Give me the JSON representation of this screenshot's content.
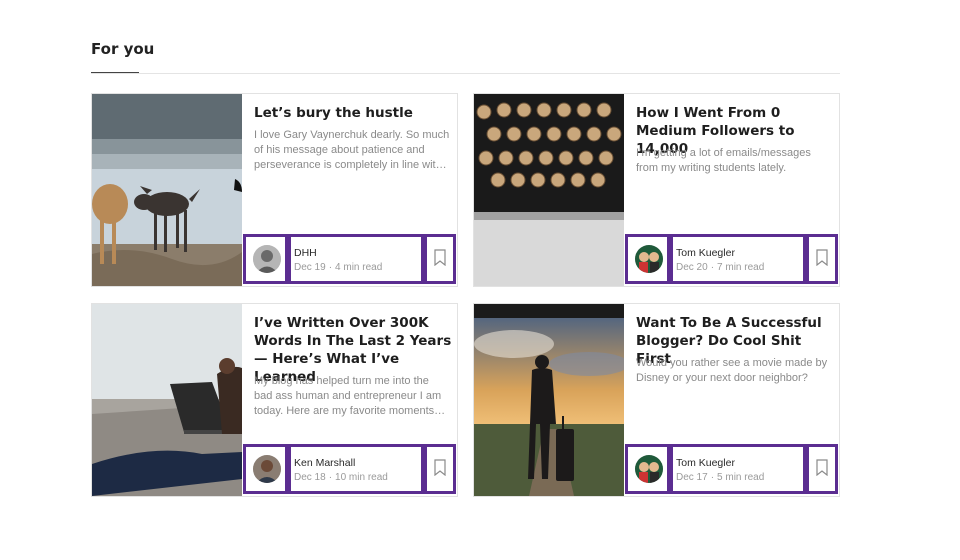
{
  "section": {
    "title": "For you"
  },
  "cards": [
    {
      "title": "Let’s bury the hustle",
      "excerpt": "I love Gary Vaynerchuk dearly. So much of his message about patience and perseverance is completely in line wit…",
      "author": "DHH",
      "date": "Dec 19",
      "read_time": "4 min read",
      "separator": "·"
    },
    {
      "title": "How I Went From 0 Medium Followers to 14,000",
      "excerpt": "I’m getting a lot of emails/messages from my writing students lately.",
      "author": "Tom Kuegler",
      "date": "Dec 20",
      "read_time": "7 min read",
      "separator": "·"
    },
    {
      "title": "I’ve Written Over 300K Words In The Last 2 Years — Here’s What I’ve Learned",
      "excerpt": "My blog has helped turn me into the bad ass human and entrepreneur I am today. Here are my favorite moments…",
      "author": "Ken Marshall",
      "date": "Dec 18",
      "read_time": "10 min read",
      "separator": "·"
    },
    {
      "title": "Want To Be A Successful Blogger? Do Cool Shit First",
      "excerpt": "Would you rather see a movie made by Disney or your next door neighbor?",
      "author": "Tom Kuegler",
      "date": "Dec 17",
      "read_time": "5 min read",
      "separator": "·"
    }
  ],
  "colors": {
    "highlight": "#5b2d91",
    "meta_text": "#9a9a9a",
    "excerpt_text": "#8a8a8a"
  },
  "icons": {
    "bookmark": "bookmark-icon"
  }
}
